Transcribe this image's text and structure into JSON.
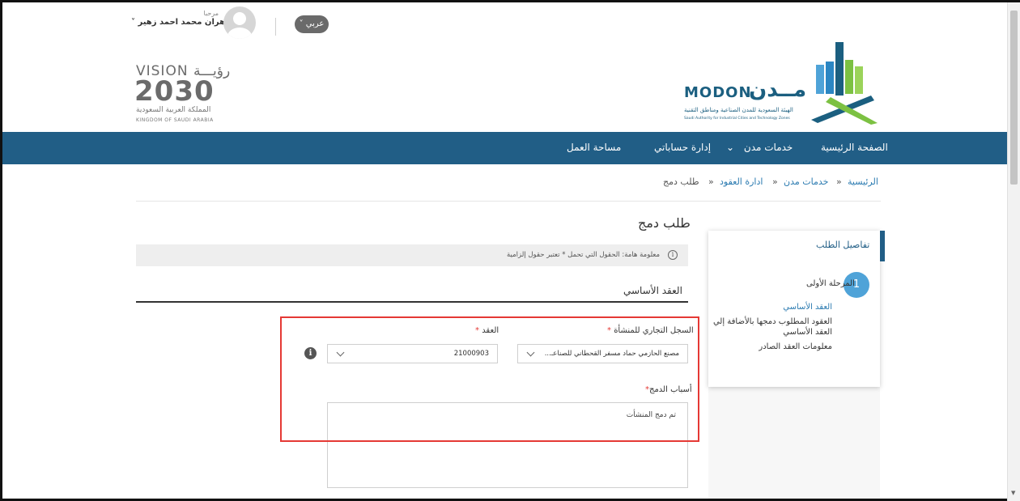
{
  "header": {
    "greeting": "مرحبا",
    "user_name": "زهران محمد احمد زهير",
    "language_button": "عربي",
    "vision_logo": {
      "top_text": "VISION رؤيـــة",
      "number": "2030",
      "arabic": "المملكة العربية السعودية",
      "english": "KINGDOM OF SAUDI ARABIA"
    },
    "modon_logo": {
      "english": "MODON",
      "arabic": "مــدن",
      "subtitle_ar": "الهيئة السعودية للمدن الصناعية ومناطق التقنية",
      "subtitle_en": "Saudi Authority for Industrial Cities and Technology Zones",
      "colors": {
        "blue": "#1b5f80",
        "green": "#7cc142",
        "light_blue": "#4fa3d8"
      }
    }
  },
  "nav": {
    "items": [
      "الصفحة الرئيسية",
      "خدمات مدن",
      "إدارة حساباتي",
      "مساحة العمل"
    ],
    "color": "#215e86"
  },
  "breadcrumb": {
    "home": "الرئيسية",
    "services": "خدمات مدن",
    "contracts": "ادارة العقود",
    "current": "طلب دمج",
    "separator": "»"
  },
  "sidebar": {
    "title": "تفاصيل الطلب",
    "step_number": "1",
    "step_title": "المرحلة الأولى",
    "items": [
      {
        "line1": "العقد الأساسي",
        "active": true
      },
      {
        "line1": "العقود المطلوب دمجها بالأضافة إلي",
        "line2": "العقد الأساسي",
        "active": false
      },
      {
        "line1": "معلومات العقد الصادر",
        "active": false
      }
    ]
  },
  "form": {
    "title": "طلب دمج",
    "info_text": "معلومة هامة: الحقول التي تحمل * تعتبر حقول إلزامية",
    "section_title": "العقد الأساسي",
    "commercial_label": "السجل التجاري للمنشأة",
    "commercial_value": "مصنع الحازمي حماد مسفر القحطاني للصناعـ...",
    "contract_label": "العقد",
    "contract_value": "21000903",
    "required_mark": "*",
    "reason_label": "أسباب الدمج",
    "reason_value": "تم دمج المنشأت"
  }
}
